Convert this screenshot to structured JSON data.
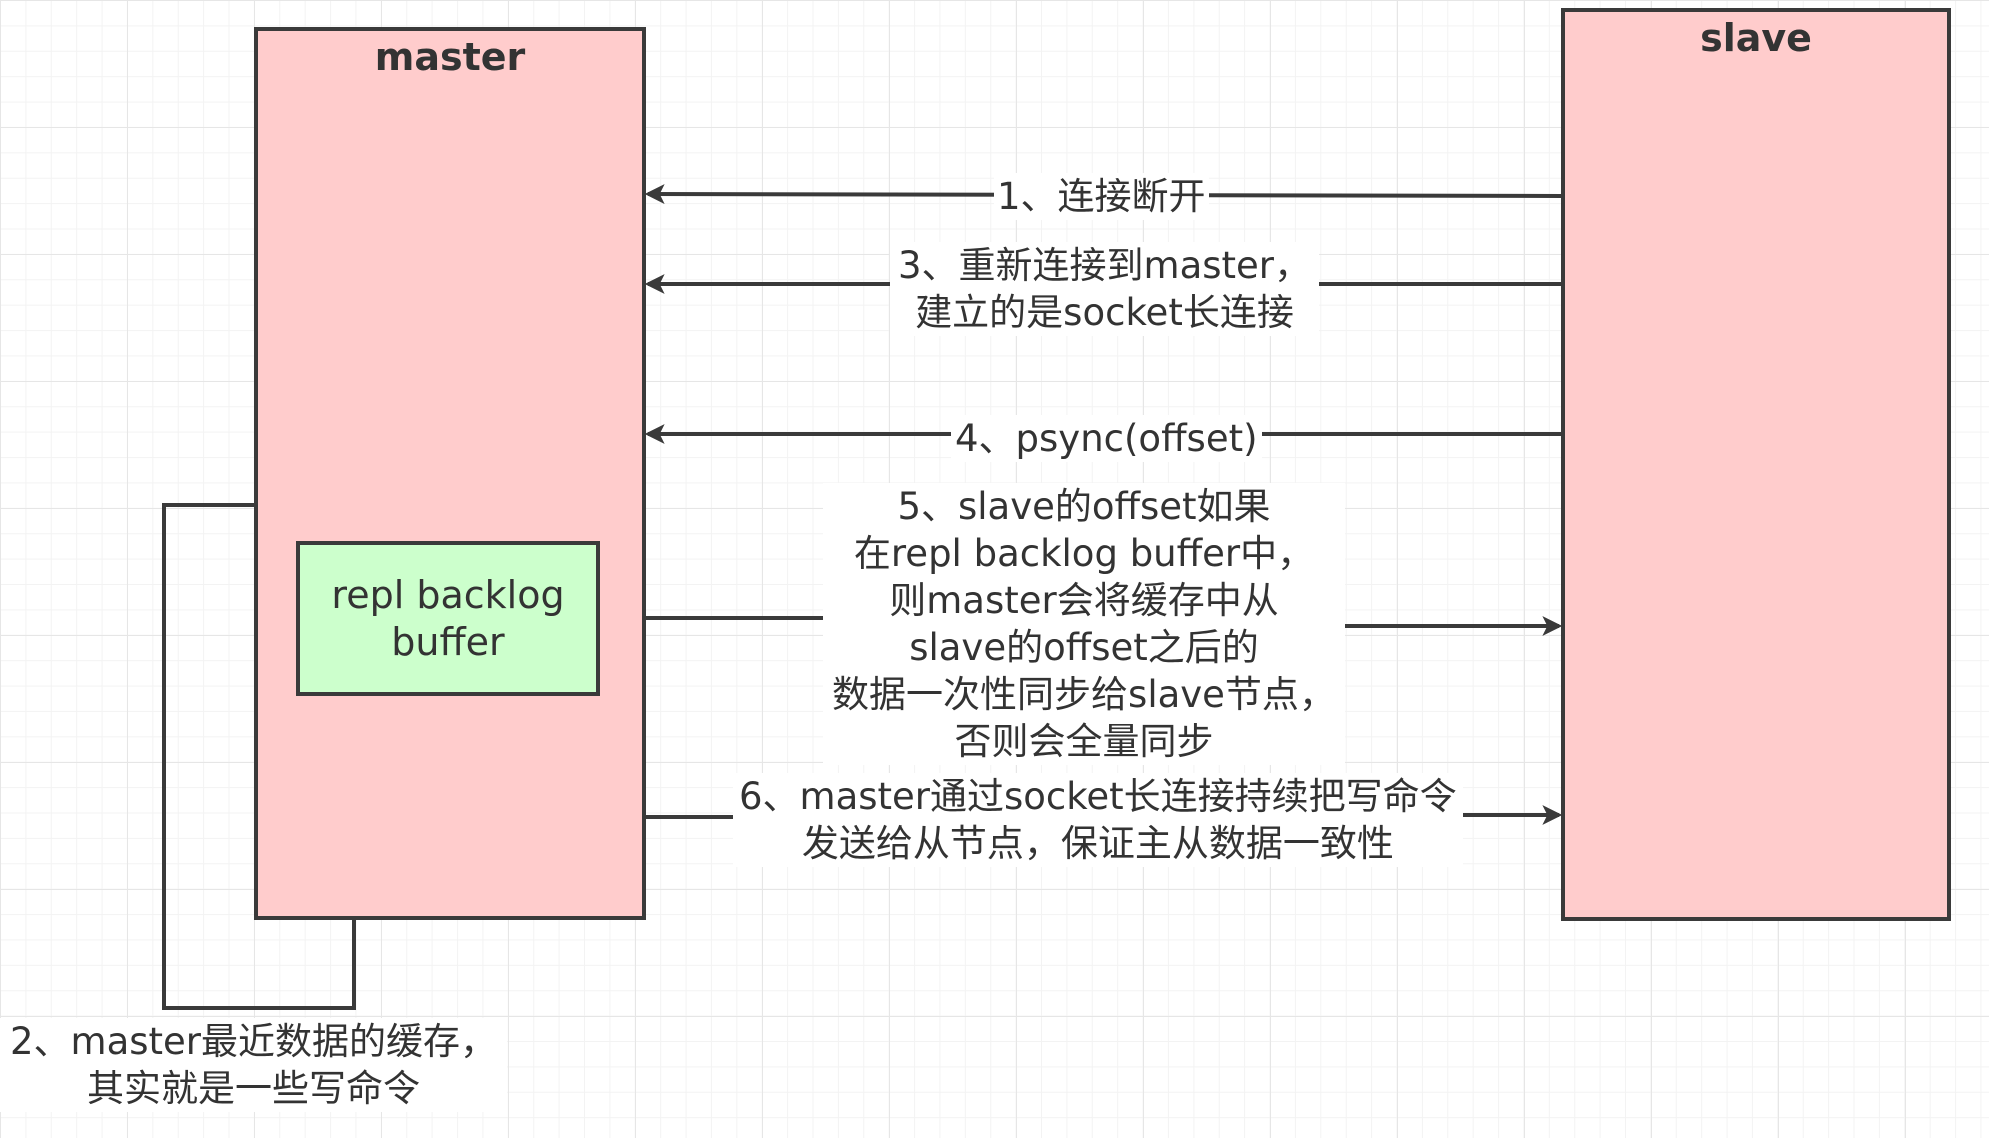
{
  "nodes": {
    "master": "master",
    "slave": "slave",
    "buffer": [
      "repl backlog",
      "buffer"
    ]
  },
  "steps": {
    "step1": [
      "1、连接断开"
    ],
    "step2": [
      "2、master最近数据的缓存，",
      "其实就是一些写命令"
    ],
    "step3": [
      "3、重新连接到master，",
      "建立的是socket长连接"
    ],
    "step4": [
      "4、psync(offset)"
    ],
    "step5": [
      "5、slave的offset如果",
      "在repl backlog buffer中，",
      "则master会将缓存中从",
      "slave的offset之后的",
      "数据一次性同步给slave节点，",
      "否则会全量同步"
    ],
    "step6": [
      "6、master通过socket长连接持续把写命令",
      "发送给从节点，保证主从数据一致性"
    ]
  },
  "colors": {
    "node_fill": "#ffcccc",
    "buffer_fill": "#ccffcc",
    "stroke": "#3a3a3a",
    "text": "#333333"
  }
}
